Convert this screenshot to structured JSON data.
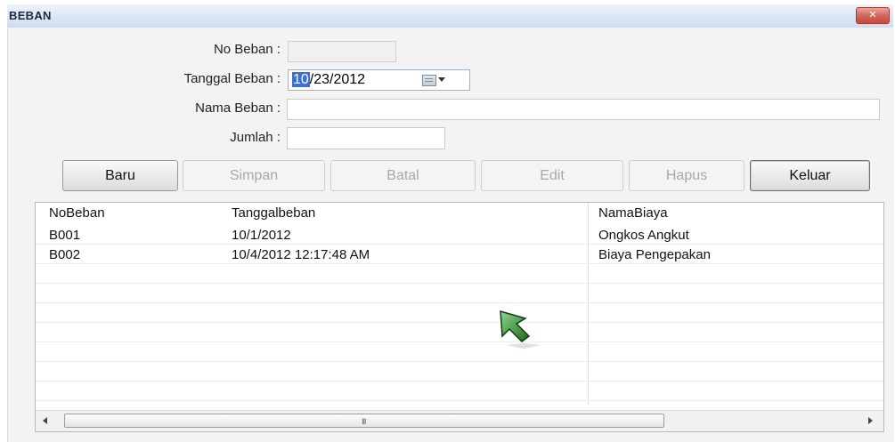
{
  "window": {
    "title": "BEBAN",
    "close_glyph": "✕"
  },
  "form": {
    "no_beban": {
      "label": "No Beban :",
      "value": ""
    },
    "tanggal_beban": {
      "label": "Tanggal Beban :",
      "value_highlighted": "10",
      "value_rest": "/23/2012",
      "icon": "calendar-icon"
    },
    "nama_beban": {
      "label": "Nama Beban :",
      "value": ""
    },
    "jumlah": {
      "label": "Jumlah :",
      "value": ""
    }
  },
  "toolbar": {
    "baru": "Baru",
    "simpan": "Simpan",
    "batal": "Batal",
    "edit": "Edit",
    "hapus": "Hapus",
    "keluar": "Keluar"
  },
  "grid": {
    "columns": [
      "NoBeban",
      "Tanggalbeban",
      "NamaBiaya"
    ],
    "rows": [
      [
        "B001",
        "10/1/2012",
        "Ongkos Angkut"
      ],
      [
        "B002",
        "10/4/2012 12:17:48 AM",
        "Biaya Pengepakan"
      ]
    ],
    "scroll_grip": "III"
  },
  "colors": {
    "selection": "#3d6fd1",
    "cursor": "#2e8b2e"
  }
}
